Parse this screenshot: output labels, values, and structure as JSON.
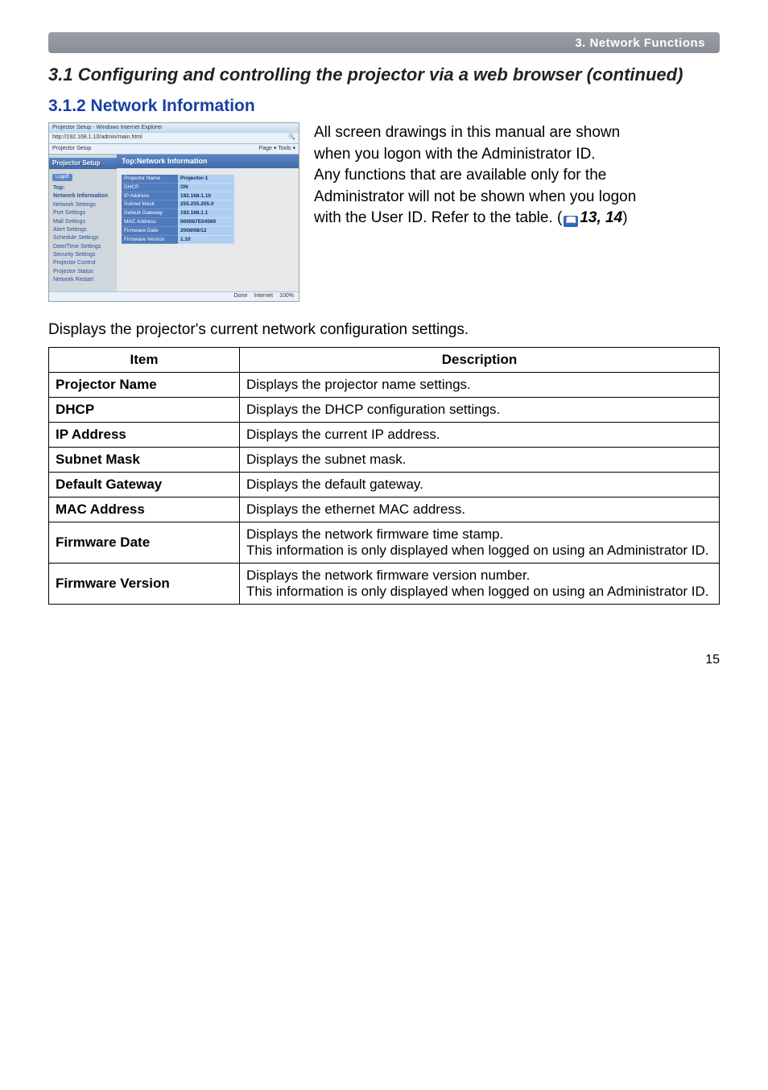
{
  "header_bar": "3. Network Functions",
  "cont_title": "3.1 Configuring and controlling the projector via a web browser (continued)",
  "section_title": "3.1.2 Network Information",
  "intro_text": {
    "l1": "All screen drawings in this manual are shown",
    "l2": "when you logon with the Administrator ID.",
    "l3": "Any functions that are available only for the",
    "l4": "Administrator will not be shown when you logon",
    "l5": "with the User ID. Refer to the table. (",
    "ref": "13, 14",
    "close": ")"
  },
  "displays_text": "Displays the projector's current network configuration settings.",
  "table": {
    "h_item": "Item",
    "h_desc": "Description",
    "rows": [
      {
        "item": "Projector Name",
        "desc": "Displays the projector name settings."
      },
      {
        "item": "DHCP",
        "desc": "Displays the DHCP configuration settings."
      },
      {
        "item": "IP Address",
        "desc": "Displays the current IP address."
      },
      {
        "item": "Subnet Mask",
        "desc": "Displays the subnet mask."
      },
      {
        "item": "Default Gateway",
        "desc": "Displays the default gateway."
      },
      {
        "item": "MAC Address",
        "desc": "Displays the ethernet MAC address."
      },
      {
        "item": "Firmware Date",
        "desc": "Displays the network firmware time stamp.\nThis information is only displayed when logged on using an Administrator ID."
      },
      {
        "item": "Firmware Version",
        "desc": "Displays the network firmware version number.\nThis information is only displayed when logged on using an Administrator ID."
      }
    ]
  },
  "page_number": "15",
  "screenshot": {
    "window_title": "Projector Setup - Windows Internet Explorer",
    "address": "http://192.168.1.10/admin/main.html",
    "tab": "Projector Setup",
    "side_header": "Projector Setup",
    "logoff": "Logoff",
    "nav": [
      "Top:",
      "Network Information",
      "Network Settings",
      "Port Settings",
      "Mail Settings",
      "Alert Settings",
      "Schedule Settings",
      "Date/Time Settings",
      "Security Settings",
      "Projector Control",
      "Projector Status",
      "Network Restart"
    ],
    "main_bar": "Top:Network Information",
    "rows": [
      {
        "k": "Projector Name",
        "v": "Projector-1"
      },
      {
        "k": "DHCP",
        "v": "ON"
      },
      {
        "k": "IP Address",
        "v": "192.168.1.10"
      },
      {
        "k": "Subnet Mask",
        "v": "255.255.255.0"
      },
      {
        "k": "Default Gateway",
        "v": "192.168.1.1"
      },
      {
        "k": "MAC Address",
        "v": "000087E04560"
      },
      {
        "k": "Firmware Date",
        "v": "2008/08/12"
      },
      {
        "k": "Firmware Version",
        "v": "1.10"
      }
    ],
    "footer_left": "Done",
    "footer_mid": "Internet",
    "footer_right": "100%"
  }
}
